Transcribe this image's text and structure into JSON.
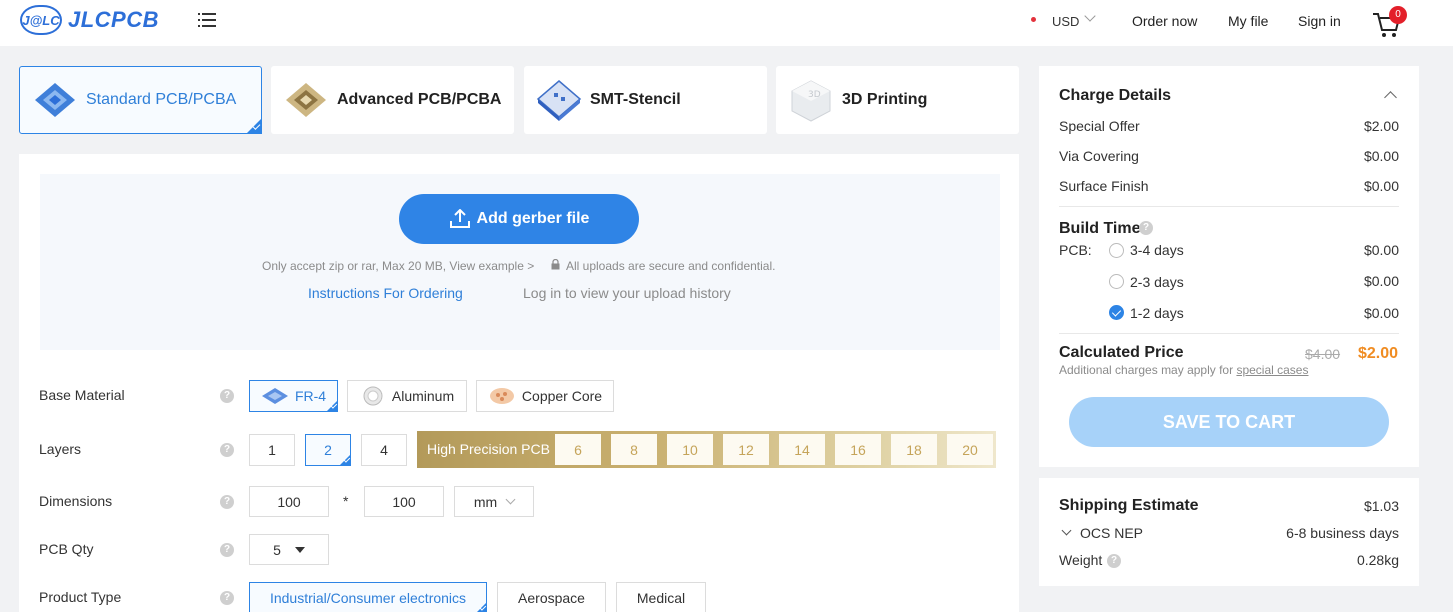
{
  "header": {
    "logo_mark": "J@LC",
    "logo_text": "JLCPCB",
    "currency": "USD",
    "order_now": "Order now",
    "my_file": "My file",
    "sign_in": "Sign in",
    "cart_count": "0"
  },
  "tabs": [
    {
      "label": "Standard PCB/PCBA",
      "active": true
    },
    {
      "label": "Advanced PCB/PCBA",
      "active": false
    },
    {
      "label": "SMT-Stencil",
      "active": false
    },
    {
      "label": "3D Printing",
      "active": false
    }
  ],
  "upload": {
    "button": "Add gerber file",
    "note_accept": "Only accept zip or rar, Max 20 MB, View example >",
    "note_secure": "All uploads are secure and confidential.",
    "instructions": "Instructions For Ordering",
    "history": "Log in to view your upload history"
  },
  "form": {
    "base_material": {
      "label": "Base Material",
      "options": [
        "FR-4",
        "Aluminum",
        "Copper Core"
      ],
      "selected": "FR-4"
    },
    "layers": {
      "label": "Layers",
      "options": [
        "1",
        "2",
        "4"
      ],
      "selected": "2",
      "high_precision_label": "High Precision PCB",
      "high_precision_options": [
        "6",
        "8",
        "10",
        "12",
        "14",
        "16",
        "18",
        "20"
      ]
    },
    "dimensions": {
      "label": "Dimensions",
      "width": "100",
      "times": "*",
      "height": "100",
      "unit": "mm"
    },
    "pcb_qty": {
      "label": "PCB Qty",
      "value": "5"
    },
    "product_type": {
      "label": "Product Type",
      "options": [
        "Industrial/Consumer electronics",
        "Aerospace",
        "Medical"
      ],
      "selected": "Industrial/Consumer electronics"
    }
  },
  "charge": {
    "title": "Charge Details",
    "items": [
      {
        "label": "Special Offer",
        "value": "$2.00"
      },
      {
        "label": "Via Covering",
        "value": "$0.00"
      },
      {
        "label": "Surface Finish",
        "value": "$0.00"
      }
    ],
    "build_time": {
      "title": "Build Time",
      "pcb_label": "PCB:",
      "options": [
        {
          "label": "3-4 days",
          "value": "$0.00",
          "selected": false
        },
        {
          "label": "2-3 days",
          "value": "$0.00",
          "selected": false
        },
        {
          "label": "1-2 days",
          "value": "$0.00",
          "selected": true
        }
      ]
    },
    "calculated": {
      "title": "Calculated Price",
      "old_price": "$4.00",
      "new_price": "$2.00",
      "note": "Additional charges may apply for",
      "note_link": "special cases"
    },
    "save_button": "SAVE TO CART"
  },
  "shipping": {
    "title": "Shipping Estimate",
    "price": "$1.03",
    "method": "OCS NEP",
    "days": "6-8 business days",
    "weight_label": "Weight",
    "weight": "0.28kg"
  },
  "colors": {
    "accent": "#2f84e6",
    "price": "#f08c22",
    "gold": "#c5a45a"
  }
}
